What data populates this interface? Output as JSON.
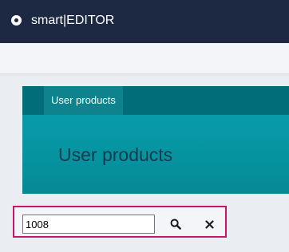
{
  "app": {
    "title": "smart|EDITOR",
    "logo_icon": "circle-dot-icon"
  },
  "banner": {
    "tab_label": "User products",
    "heading": "User products",
    "band_color": "#006d78",
    "body_color": "#079aa6"
  },
  "search": {
    "value": "1008",
    "search_icon": "search-icon",
    "clear_icon": "close-icon",
    "highlight_color": "#c4176c"
  }
}
